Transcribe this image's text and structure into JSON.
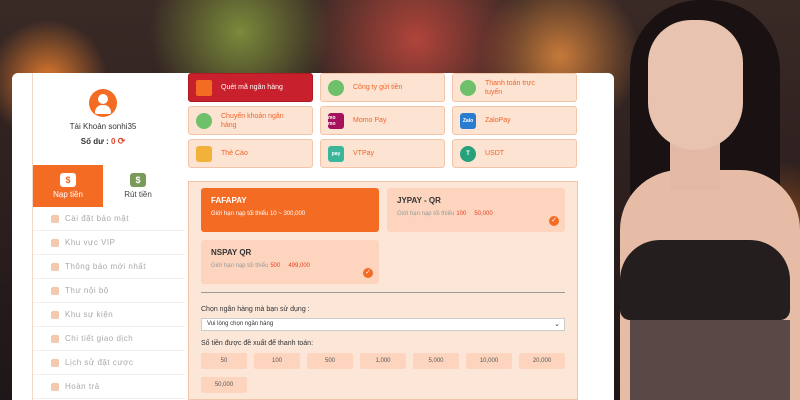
{
  "user": {
    "account_label": "Tài Khoản sonhi35",
    "balance_label": "Số dư :",
    "balance_value": "0"
  },
  "tabs": [
    {
      "label": "Nạp tiền",
      "icon": "deposit-icon"
    },
    {
      "label": "Rút tiền",
      "icon": "withdraw-icon"
    }
  ],
  "menu": [
    "Cài đặt bảo mật",
    "Khu vực VIP",
    "Thông báo mới nhất",
    "Thư nội bộ",
    "Khu sự kiện",
    "Chi tiết giao dịch",
    "Lịch sử đặt cược",
    "Hoàn trả"
  ],
  "payment_methods": [
    {
      "label": "Quét mã ngân hàng",
      "icon": "qr-icon",
      "selected": true
    },
    {
      "label": "Công ty gửi tiền",
      "icon": "globe-icon"
    },
    {
      "label": "Thanh toán trực tuyến",
      "icon": "globe-icon"
    },
    {
      "label": "Chuyển khoản ngân hàng",
      "icon": "globe-icon"
    },
    {
      "label": "Momo Pay",
      "icon": "momo-icon",
      "icon_text": "mo mo"
    },
    {
      "label": "ZaloPay",
      "icon": "zalopay-icon",
      "icon_text": "Zalo"
    },
    {
      "label": "Thẻ Cào",
      "icon": "card-icon"
    },
    {
      "label": "VTPay",
      "icon": "vtpay-icon",
      "icon_text": "pay"
    },
    {
      "label": "USDT",
      "icon": "tether-icon",
      "icon_text": "T"
    }
  ],
  "gateways": [
    {
      "title": "FAFAPAY",
      "limit_text": "Giới hạn nạp tối thiểu 10 ~ 300,000",
      "selected": true
    },
    {
      "title": "JYPAY - QR",
      "limit_prefix": "Giới hạn nạp tối thiểu",
      "min": "100",
      "max": "50,000"
    },
    {
      "title": "NSPAY QR",
      "limit_prefix": "Giới hạn nạp tối thiểu",
      "min": "500",
      "max": "499,000"
    }
  ],
  "bank_select": {
    "label": "Chọn ngân hàng mà bạn sử dụng :",
    "value": "Vui lòng chọn ngân hàng"
  },
  "amounts": {
    "label": "Số tiền được đề xuất để thanh toán:",
    "values": [
      "50",
      "100",
      "500",
      "1,000",
      "5,000",
      "10,000",
      "20,000",
      "50,000"
    ]
  },
  "colors": {
    "accent": "#f46b24",
    "selected_method": "#c8202c",
    "tile_bg": "#fde3d2"
  }
}
